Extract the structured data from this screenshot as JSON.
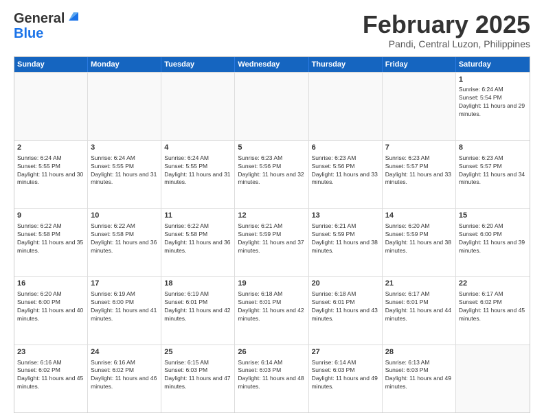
{
  "header": {
    "logo_general": "General",
    "logo_blue": "Blue",
    "month_title": "February 2025",
    "location": "Pandi, Central Luzon, Philippines"
  },
  "days_of_week": [
    "Sunday",
    "Monday",
    "Tuesday",
    "Wednesday",
    "Thursday",
    "Friday",
    "Saturday"
  ],
  "weeks": [
    [
      {
        "day": "",
        "info": ""
      },
      {
        "day": "",
        "info": ""
      },
      {
        "day": "",
        "info": ""
      },
      {
        "day": "",
        "info": ""
      },
      {
        "day": "",
        "info": ""
      },
      {
        "day": "",
        "info": ""
      },
      {
        "day": "1",
        "info": "Sunrise: 6:24 AM\nSunset: 5:54 PM\nDaylight: 11 hours and 29 minutes."
      }
    ],
    [
      {
        "day": "2",
        "info": "Sunrise: 6:24 AM\nSunset: 5:55 PM\nDaylight: 11 hours and 30 minutes."
      },
      {
        "day": "3",
        "info": "Sunrise: 6:24 AM\nSunset: 5:55 PM\nDaylight: 11 hours and 31 minutes."
      },
      {
        "day": "4",
        "info": "Sunrise: 6:24 AM\nSunset: 5:55 PM\nDaylight: 11 hours and 31 minutes."
      },
      {
        "day": "5",
        "info": "Sunrise: 6:23 AM\nSunset: 5:56 PM\nDaylight: 11 hours and 32 minutes."
      },
      {
        "day": "6",
        "info": "Sunrise: 6:23 AM\nSunset: 5:56 PM\nDaylight: 11 hours and 33 minutes."
      },
      {
        "day": "7",
        "info": "Sunrise: 6:23 AM\nSunset: 5:57 PM\nDaylight: 11 hours and 33 minutes."
      },
      {
        "day": "8",
        "info": "Sunrise: 6:23 AM\nSunset: 5:57 PM\nDaylight: 11 hours and 34 minutes."
      }
    ],
    [
      {
        "day": "9",
        "info": "Sunrise: 6:22 AM\nSunset: 5:58 PM\nDaylight: 11 hours and 35 minutes."
      },
      {
        "day": "10",
        "info": "Sunrise: 6:22 AM\nSunset: 5:58 PM\nDaylight: 11 hours and 36 minutes."
      },
      {
        "day": "11",
        "info": "Sunrise: 6:22 AM\nSunset: 5:58 PM\nDaylight: 11 hours and 36 minutes."
      },
      {
        "day": "12",
        "info": "Sunrise: 6:21 AM\nSunset: 5:59 PM\nDaylight: 11 hours and 37 minutes."
      },
      {
        "day": "13",
        "info": "Sunrise: 6:21 AM\nSunset: 5:59 PM\nDaylight: 11 hours and 38 minutes."
      },
      {
        "day": "14",
        "info": "Sunrise: 6:20 AM\nSunset: 5:59 PM\nDaylight: 11 hours and 38 minutes."
      },
      {
        "day": "15",
        "info": "Sunrise: 6:20 AM\nSunset: 6:00 PM\nDaylight: 11 hours and 39 minutes."
      }
    ],
    [
      {
        "day": "16",
        "info": "Sunrise: 6:20 AM\nSunset: 6:00 PM\nDaylight: 11 hours and 40 minutes."
      },
      {
        "day": "17",
        "info": "Sunrise: 6:19 AM\nSunset: 6:00 PM\nDaylight: 11 hours and 41 minutes."
      },
      {
        "day": "18",
        "info": "Sunrise: 6:19 AM\nSunset: 6:01 PM\nDaylight: 11 hours and 42 minutes."
      },
      {
        "day": "19",
        "info": "Sunrise: 6:18 AM\nSunset: 6:01 PM\nDaylight: 11 hours and 42 minutes."
      },
      {
        "day": "20",
        "info": "Sunrise: 6:18 AM\nSunset: 6:01 PM\nDaylight: 11 hours and 43 minutes."
      },
      {
        "day": "21",
        "info": "Sunrise: 6:17 AM\nSunset: 6:01 PM\nDaylight: 11 hours and 44 minutes."
      },
      {
        "day": "22",
        "info": "Sunrise: 6:17 AM\nSunset: 6:02 PM\nDaylight: 11 hours and 45 minutes."
      }
    ],
    [
      {
        "day": "23",
        "info": "Sunrise: 6:16 AM\nSunset: 6:02 PM\nDaylight: 11 hours and 45 minutes."
      },
      {
        "day": "24",
        "info": "Sunrise: 6:16 AM\nSunset: 6:02 PM\nDaylight: 11 hours and 46 minutes."
      },
      {
        "day": "25",
        "info": "Sunrise: 6:15 AM\nSunset: 6:03 PM\nDaylight: 11 hours and 47 minutes."
      },
      {
        "day": "26",
        "info": "Sunrise: 6:14 AM\nSunset: 6:03 PM\nDaylight: 11 hours and 48 minutes."
      },
      {
        "day": "27",
        "info": "Sunrise: 6:14 AM\nSunset: 6:03 PM\nDaylight: 11 hours and 49 minutes."
      },
      {
        "day": "28",
        "info": "Sunrise: 6:13 AM\nSunset: 6:03 PM\nDaylight: 11 hours and 49 minutes."
      },
      {
        "day": "",
        "info": ""
      }
    ]
  ]
}
